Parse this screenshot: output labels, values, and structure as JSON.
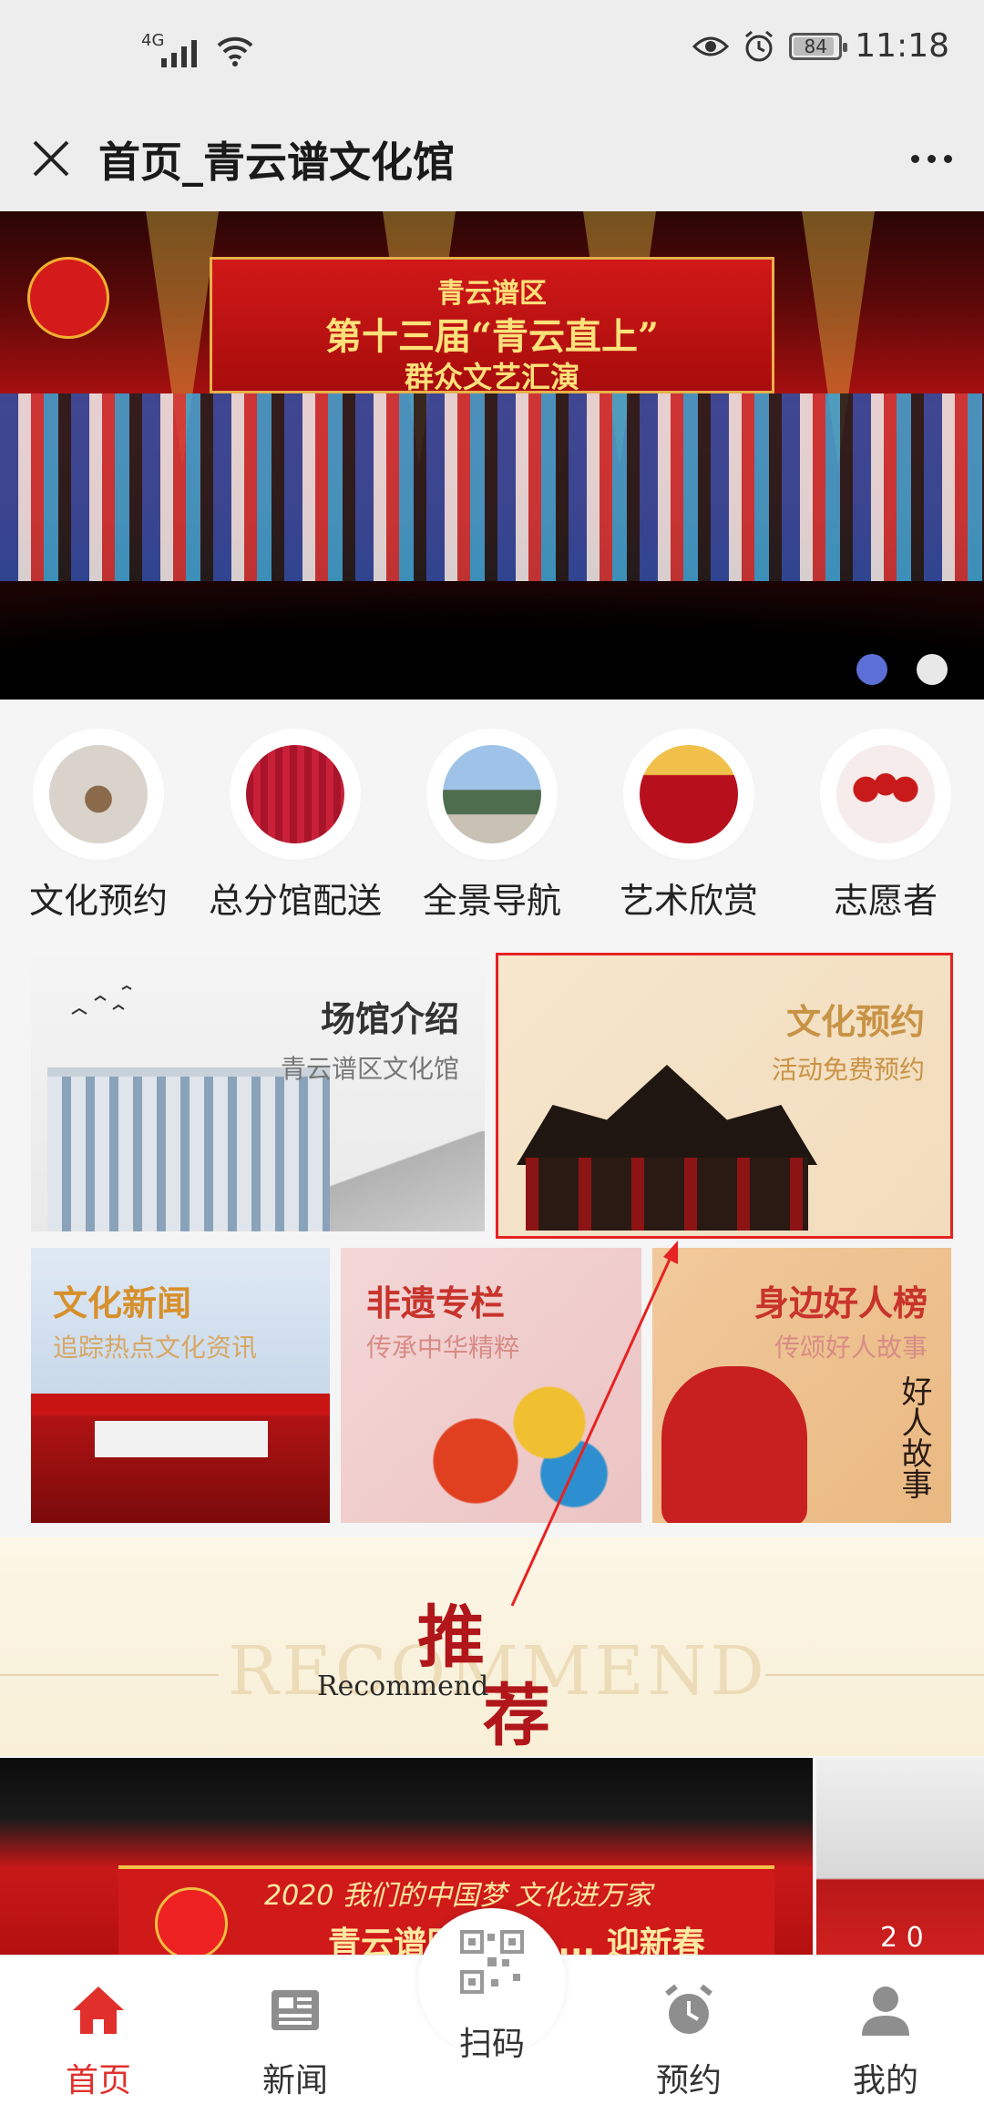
{
  "status_bar": {
    "network": "4G",
    "battery": "84",
    "time": "11:18"
  },
  "title_bar": {
    "title": "首页_青云谱文化馆"
  },
  "banner": {
    "stage_line1": "青云谱区",
    "stage_line2": "第十三届“青云直上”",
    "stage_line3": "群众文艺汇演",
    "slide_count": 2,
    "active_slide": 1
  },
  "quick_links": [
    {
      "label": "文化预约",
      "icon": "hallway-photo-icon"
    },
    {
      "label": "总分馆配送",
      "icon": "banner-photo-icon"
    },
    {
      "label": "全景导航",
      "icon": "panorama-photo-icon"
    },
    {
      "label": "艺术欣赏",
      "icon": "theater-photo-icon"
    },
    {
      "label": "志愿者",
      "icon": "volunteer-photo-icon"
    }
  ],
  "tiles": {
    "venue": {
      "title": "场馆介绍",
      "subtitle": "青云谱区文化馆"
    },
    "booking": {
      "title": "文化预约",
      "subtitle": "活动免费预约"
    },
    "news": {
      "title": "文化新闻",
      "subtitle": "追踪热点文化资讯"
    },
    "heritage": {
      "title": "非遗专栏",
      "subtitle": "传承中华精粹"
    },
    "good_people": {
      "title": "身边好人榜",
      "subtitle": "传颂好人故事",
      "calligraphy": "好人故事"
    }
  },
  "recommend": {
    "watermark": "RECOMMEND",
    "english": "Recommend",
    "chinese_1": "推",
    "chinese_2": "荐"
  },
  "recommend_cards": [
    {
      "caption_1": "2020 我们的中国梦 文化进万家",
      "caption_2": "青云谱区“歌唱 ... 迎新春"
    },
    {
      "caption_1": "2 0"
    }
  ],
  "colors": {
    "accent_red": "#e1302c",
    "highlight_border": "#e62222",
    "gold": "#c89346",
    "slide_active": "#5b6fd6"
  },
  "bottom_nav": [
    {
      "label": "首页",
      "icon": "home-icon",
      "active": true
    },
    {
      "label": "新闻",
      "icon": "news-icon",
      "active": false
    },
    {
      "label": "扫码",
      "icon": "qr-scan-icon",
      "active": false
    },
    {
      "label": "预约",
      "icon": "alarm-clock-icon",
      "active": false
    },
    {
      "label": "我的",
      "icon": "user-icon",
      "active": false
    }
  ]
}
